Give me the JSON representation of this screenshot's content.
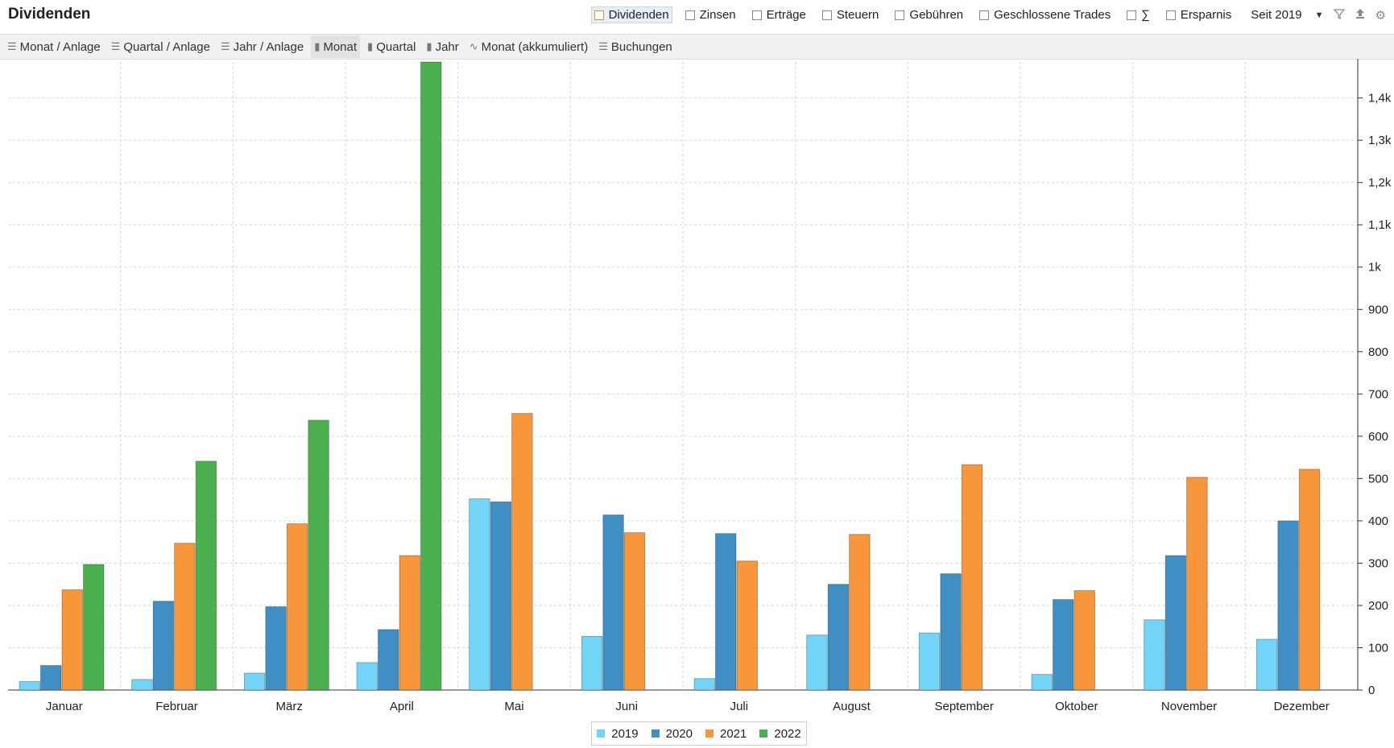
{
  "header": {
    "title": "Dividenden",
    "filters": [
      {
        "label": "Dividenden",
        "active": true
      },
      {
        "label": "Zinsen",
        "active": false
      },
      {
        "label": "Erträge",
        "active": false
      },
      {
        "label": "Steuern",
        "active": false
      },
      {
        "label": "Gebühren",
        "active": false
      },
      {
        "label": "Geschlossene Trades",
        "active": false
      },
      {
        "label": "∑",
        "active": false
      },
      {
        "label": "Ersparnis",
        "active": false
      }
    ],
    "period": "Seit 2019",
    "icons": [
      "filter-icon",
      "export-icon",
      "settings-icon"
    ]
  },
  "toolbar": {
    "tabs": [
      {
        "label": "Monat / Anlage",
        "icon": "list-icon",
        "active": false
      },
      {
        "label": "Quartal / Anlage",
        "icon": "list-icon",
        "active": false
      },
      {
        "label": "Jahr / Anlage",
        "icon": "list-icon",
        "active": false
      },
      {
        "label": "Monat",
        "icon": "bar-chart-icon",
        "active": true
      },
      {
        "label": "Quartal",
        "icon": "bar-chart-icon",
        "active": false
      },
      {
        "label": "Jahr",
        "icon": "bar-chart-icon",
        "active": false
      },
      {
        "label": "Monat (akkumuliert)",
        "icon": "line-chart-icon",
        "active": false
      },
      {
        "label": "Buchungen",
        "icon": "list-icon",
        "active": false
      }
    ]
  },
  "chart_data": {
    "type": "bar",
    "categories": [
      "Januar",
      "Februar",
      "März",
      "April",
      "Mai",
      "Juni",
      "Juli",
      "August",
      "September",
      "Oktober",
      "November",
      "Dezember"
    ],
    "series": [
      {
        "name": "2019",
        "color": "#72d5f7",
        "values": [
          20,
          25,
          40,
          65,
          452,
          127,
          27,
          130,
          135,
          37,
          166,
          120
        ]
      },
      {
        "name": "2020",
        "color": "#3f8fc4",
        "values": [
          58,
          210,
          197,
          143,
          445,
          414,
          370,
          250,
          275,
          214,
          318,
          400
        ]
      },
      {
        "name": "2021",
        "color": "#f7963a",
        "values": [
          237,
          347,
          393,
          318,
          654,
          372,
          305,
          368,
          533,
          235,
          503,
          522
        ]
      },
      {
        "name": "2022",
        "color": "#4caf50",
        "values": [
          297,
          541,
          638,
          1485,
          null,
          null,
          null,
          null,
          null,
          null,
          null,
          null
        ]
      }
    ],
    "ylim": [
      0,
      1485
    ],
    "yticks": [
      0,
      100,
      200,
      300,
      400,
      500,
      600,
      700,
      800,
      900,
      1000,
      1100,
      1200,
      1300,
      1400
    ],
    "ytick_labels": [
      "0",
      "100",
      "200",
      "300",
      "400",
      "500",
      "600",
      "700",
      "800",
      "900",
      "1k",
      "1,1k",
      "1,2k",
      "1,3k",
      "1,4k"
    ],
    "y_axis_side": "right",
    "grid": true,
    "legend": "bottom-center"
  }
}
